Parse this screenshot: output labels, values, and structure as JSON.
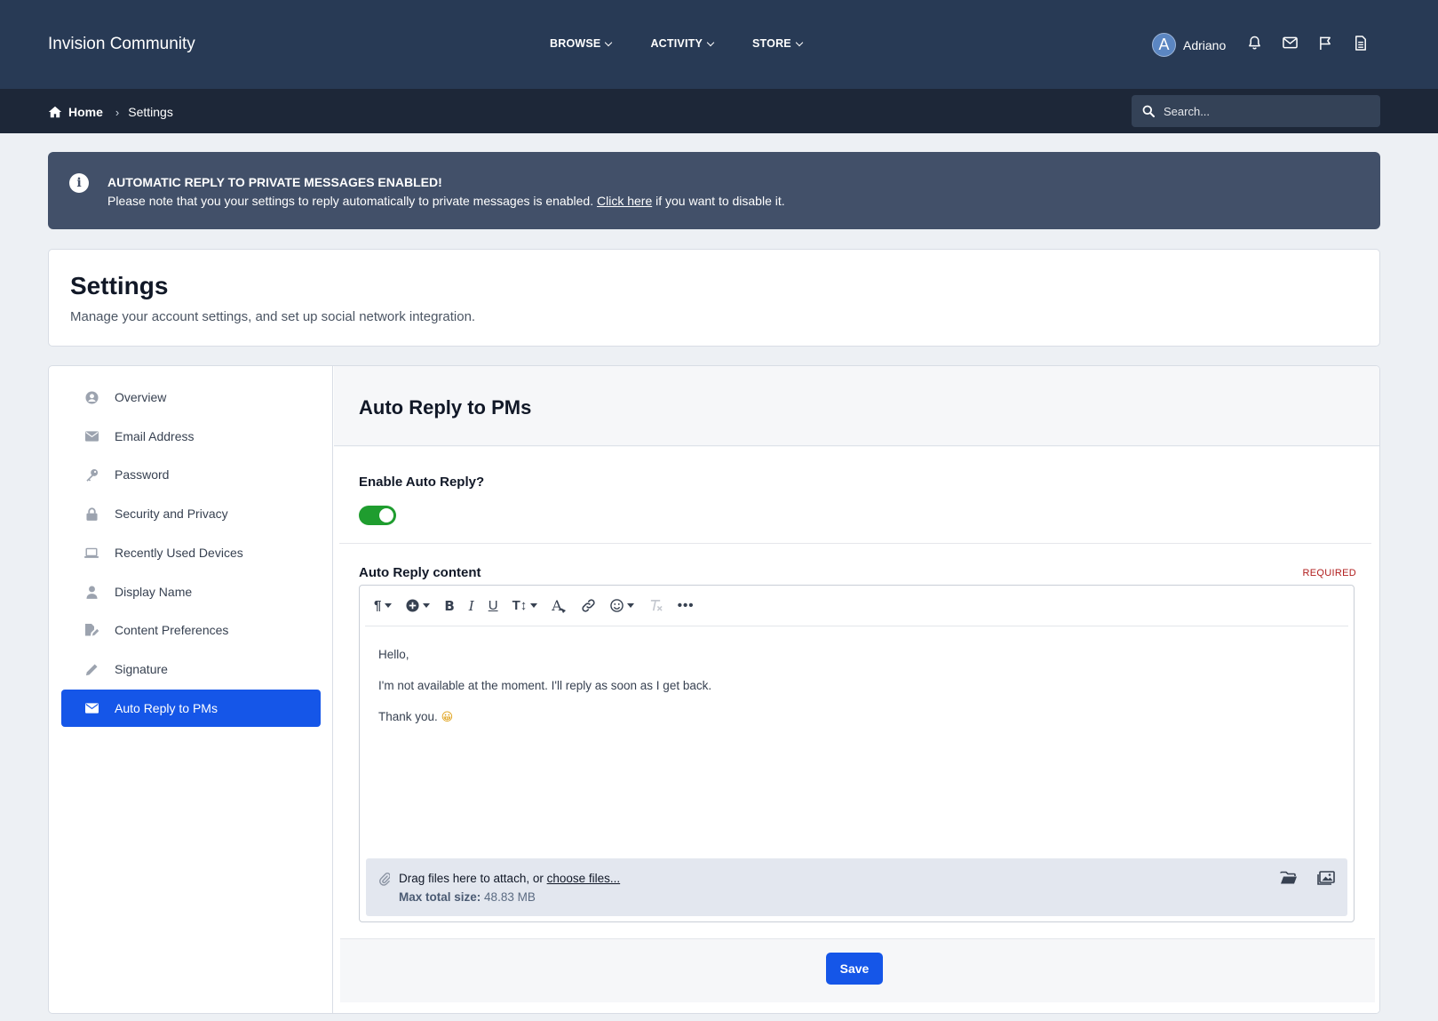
{
  "header": {
    "brand": "Invision Community",
    "nav": [
      {
        "label": "BROWSE",
        "icon": "chevron-down-icon"
      },
      {
        "label": "ACTIVITY",
        "icon": "chevron-down-icon"
      },
      {
        "label": "STORE",
        "icon": "chevron-down-icon"
      }
    ],
    "user": {
      "initial": "A",
      "name": "Adriano"
    },
    "icons": [
      "bell-icon",
      "envelope-icon",
      "flag-icon",
      "document-icon"
    ],
    "colors": {
      "bar": "#283a55",
      "subbar": "#1d2738"
    }
  },
  "breadcrumb": {
    "home": "Home",
    "current": "Settings"
  },
  "search": {
    "placeholder": "Search..."
  },
  "alert": {
    "title": "AUTOMATIC REPLY TO PRIVATE MESSAGES ENABLED!",
    "body_before": "Please note that you your settings to reply automatically to private messages is enabled.",
    "link": "Click here",
    "body_after": "if you want to disable it."
  },
  "page": {
    "title": "Settings",
    "description": "Manage your account settings, and set up social network integration."
  },
  "sidebar": {
    "items": [
      {
        "label": "Overview",
        "icon": "user-circle-icon",
        "active": false
      },
      {
        "label": "Email Address",
        "icon": "envelope-icon",
        "active": false
      },
      {
        "label": "Password",
        "icon": "key-icon",
        "active": false
      },
      {
        "label": "Security and Privacy",
        "icon": "lock-icon",
        "active": false
      },
      {
        "label": "Recently Used Devices",
        "icon": "laptop-icon",
        "active": false
      },
      {
        "label": "Display Name",
        "icon": "user-icon",
        "active": false
      },
      {
        "label": "Content Preferences",
        "icon": "file-edit-icon",
        "active": false
      },
      {
        "label": "Signature",
        "icon": "pencil-icon",
        "active": false
      },
      {
        "label": "Auto Reply to PMs",
        "icon": "envelope-icon",
        "active": true
      }
    ]
  },
  "form": {
    "title": "Auto Reply to PMs",
    "enable_label": "Enable Auto Reply?",
    "enable_value": true,
    "content_label": "Auto Reply content",
    "required": "REQUIRED",
    "editor": {
      "toolbar": [
        "paragraph-icon",
        "insert-icon",
        "bold-icon",
        "italic-icon",
        "underline-icon",
        "text-size-icon",
        "text-color-icon",
        "link-icon",
        "emoji-icon",
        "remove-format-icon",
        "more-icon"
      ],
      "lines": [
        "Hello,",
        "I'm not available at the moment. I'll reply as soon as I get back.",
        "Thank you."
      ],
      "emoji": "😀"
    },
    "attach": {
      "text": "Drag files here to attach, or",
      "link": "choose files...",
      "max_label": "Max total size:",
      "max_value": "48.83 MB"
    },
    "save": "Save",
    "colors": {
      "accent": "#1556e8",
      "toggle": "#1f9d2f",
      "required": "#b01c1c"
    }
  }
}
